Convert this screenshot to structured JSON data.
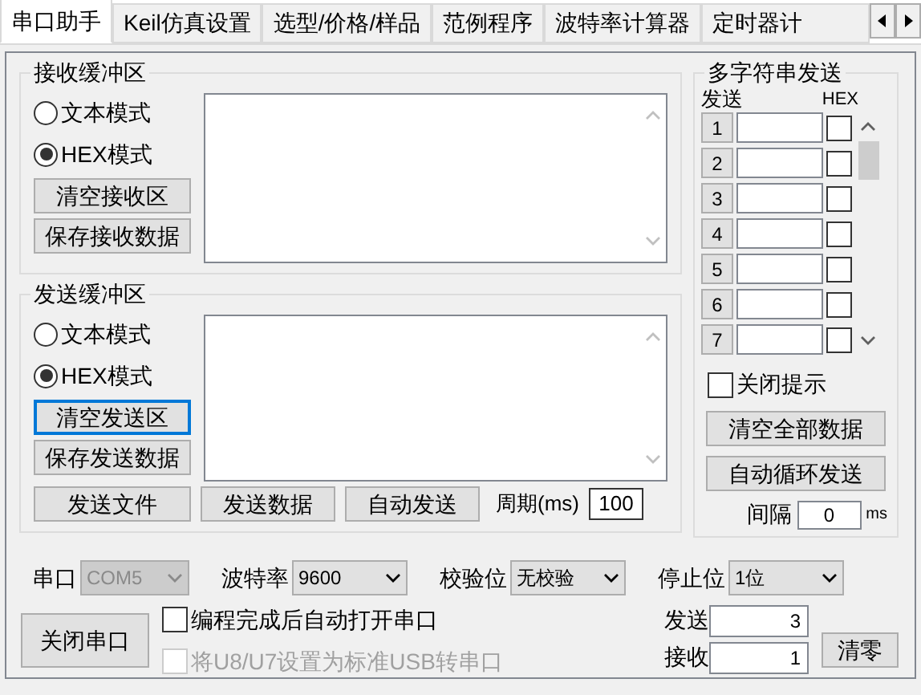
{
  "tabs": [
    {
      "label": "串口助手",
      "selected": true
    },
    {
      "label": "Keil仿真设置",
      "selected": false
    },
    {
      "label": "选型/价格/样品",
      "selected": false
    },
    {
      "label": "范例程序",
      "selected": false
    },
    {
      "label": "波特率计算器",
      "selected": false
    },
    {
      "label": "定时器计",
      "selected": false
    }
  ],
  "receive_buffer": {
    "title": "接收缓冲区",
    "modes": [
      {
        "label": "文本模式",
        "selected": false
      },
      {
        "label": "HEX模式",
        "selected": true
      }
    ],
    "buttons": [
      {
        "label": "清空接收区",
        "focused": false
      },
      {
        "label": "保存接收数据",
        "focused": false
      }
    ]
  },
  "send_buffer": {
    "title": "发送缓冲区",
    "modes": [
      {
        "label": "文本模式",
        "selected": false
      },
      {
        "label": "HEX模式",
        "selected": true
      }
    ],
    "buttons": [
      {
        "label": "清空发送区",
        "focused": true
      },
      {
        "label": "保存发送数据",
        "focused": false
      }
    ],
    "action_buttons": [
      "发送文件",
      "发送数据",
      "自动发送"
    ],
    "period_label": "周期(ms)",
    "period_value": "100"
  },
  "multi_send": {
    "title": "多字符串发送",
    "send_header": "发送",
    "hex_header": "HEX",
    "rows": [
      {
        "number": "1",
        "hex": false
      },
      {
        "number": "2",
        "hex": false
      },
      {
        "number": "3",
        "hex": false
      },
      {
        "number": "4",
        "hex": false
      },
      {
        "number": "5",
        "hex": false
      },
      {
        "number": "6",
        "hex": false
      },
      {
        "number": "7",
        "hex": false
      }
    ],
    "close_hint": {
      "label": "关闭提示",
      "checked": false
    },
    "buttons": [
      "清空全部数据",
      "自动循环发送"
    ],
    "interval_label": "间隔",
    "interval_value": "0",
    "interval_unit": "ms"
  },
  "port_settings": [
    {
      "label": "串口",
      "value": "COM5",
      "disabled": true
    },
    {
      "label": "波特率",
      "value": "9600",
      "disabled": false
    },
    {
      "label": "校验位",
      "value": "无校验",
      "disabled": false
    },
    {
      "label": "停止位",
      "value": "1位",
      "disabled": false
    }
  ],
  "close_port_button": "关闭串口",
  "options": [
    {
      "label": "编程完成后自动打开串口",
      "checked": false,
      "disabled": false
    },
    {
      "label": "将U8/U7设置为标准USB转串口",
      "checked": false,
      "disabled": true
    }
  ],
  "counters": [
    {
      "label": "发送",
      "value": "3"
    },
    {
      "label": "接收",
      "value": "1"
    }
  ],
  "clear_counts_button": "清零"
}
